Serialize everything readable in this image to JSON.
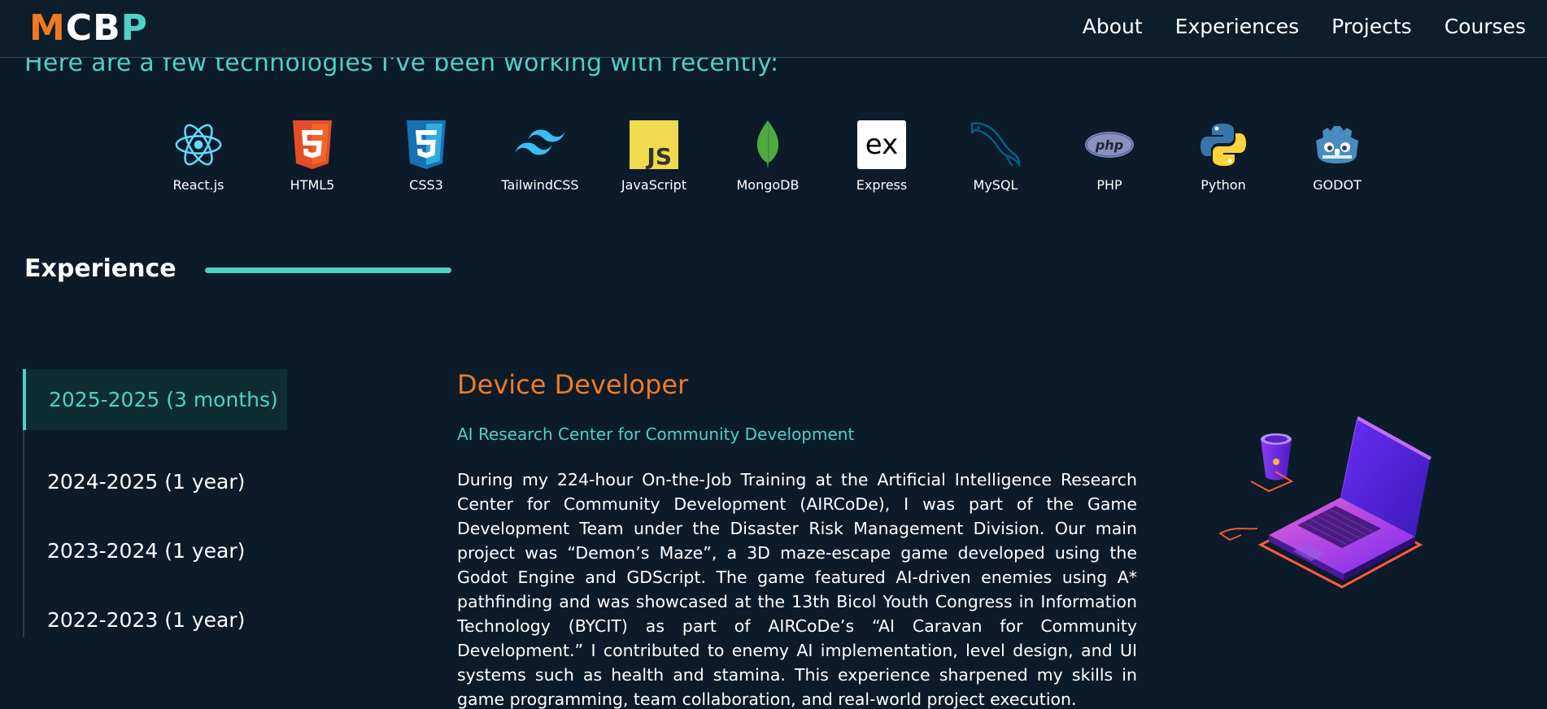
{
  "header": {
    "logo": [
      "M",
      "C",
      "B",
      "P"
    ],
    "nav": [
      "About",
      "Experiences",
      "Projects",
      "Courses"
    ]
  },
  "tech": {
    "heading": "Here are a few technologies I've been working with recently:",
    "items": [
      {
        "label": "React.js",
        "icon": "react-icon"
      },
      {
        "label": "HTML5",
        "icon": "html5-icon"
      },
      {
        "label": "CSS3",
        "icon": "css3-icon"
      },
      {
        "label": "TailwindCSS",
        "icon": "tailwind-icon"
      },
      {
        "label": "JavaScript",
        "icon": "javascript-icon"
      },
      {
        "label": "MongoDB",
        "icon": "mongodb-icon"
      },
      {
        "label": "Express",
        "icon": "express-icon"
      },
      {
        "label": "MySQL",
        "icon": "mysql-icon"
      },
      {
        "label": "PHP",
        "icon": "php-icon"
      },
      {
        "label": "Python",
        "icon": "python-icon"
      },
      {
        "label": "GODOT",
        "icon": "godot-icon"
      }
    ]
  },
  "experience": {
    "title": "Experience",
    "tabs": [
      "2025-2025 (3 months)",
      "2024-2025 (1 year)",
      "2023-2024 (1 year)",
      "2022-2023 (1 year)"
    ],
    "active": {
      "role": "Device Developer",
      "company": "AI Research Center for Community Development",
      "description": "During my 224-hour On-the-Job Training at the Artificial Intelligence Research Center for Community Development (AIRCoDe), I was part of the Game Development Team under the Disaster Risk Management Division. Our main project was “Demon’s Maze”, a 3D maze-escape game developed using the Godot Engine and GDScript. The game featured AI-driven enemies using A* pathfinding and was showcased at the 13th Bicol Youth Congress in Information Technology (BYCIT) as part of AIRCoDe’s “AI Caravan for Community Development.” I contributed to enemy AI implementation, level design, and UI systems such as health and stamina. This experience sharpened my skills in game programming, team collaboration, and real-world project execution."
    }
  },
  "colors": {
    "accent": "#4fd1c5",
    "orange": "#f07a22",
    "background": "#0b1b2a"
  }
}
